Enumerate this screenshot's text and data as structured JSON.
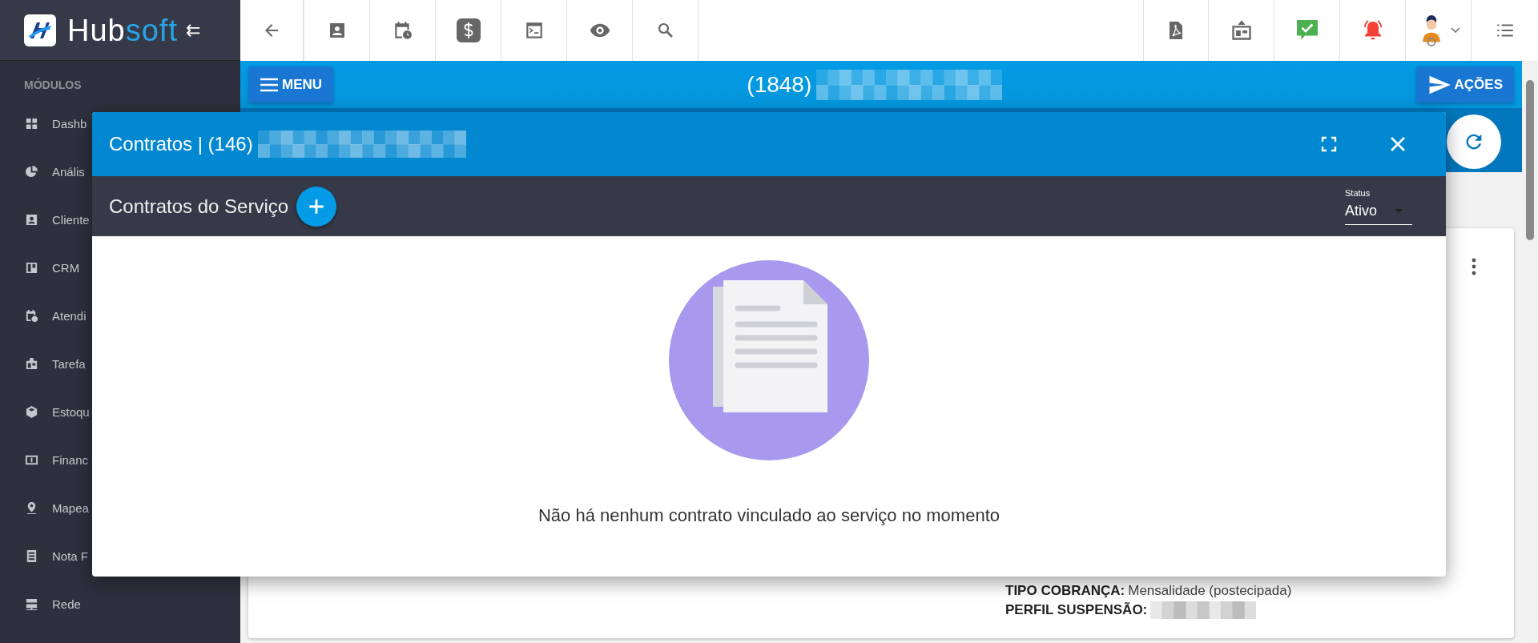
{
  "sidebar": {
    "logo": {
      "text_main": "Hub",
      "text_accent": "soft"
    },
    "collapse_icon": "⇇",
    "section_title": "MÓDULOS",
    "items": [
      {
        "label": "Dashb"
      },
      {
        "label": "Anális"
      },
      {
        "label": "Cliente"
      },
      {
        "label": "CRM"
      },
      {
        "label": "Atendi"
      },
      {
        "label": "Tarefa"
      },
      {
        "label": "Estoqu"
      },
      {
        "label": "Financ"
      },
      {
        "label": "Mapea"
      },
      {
        "label": "Nota F"
      },
      {
        "label": "Rede"
      }
    ]
  },
  "page_bar": {
    "menu_button": "MENU",
    "title": "(1848)",
    "actions_button": "AÇÕES"
  },
  "background_card": {
    "fields": [
      {
        "label": "TIPO COBRANÇA:",
        "value": "Mensalidade (postecipada)"
      },
      {
        "label": "PERFIL SUSPENSÃO:"
      }
    ]
  },
  "modal": {
    "title": "Contratos | (146)",
    "subtitle": "Contratos do Serviço",
    "status_filter": {
      "label": "Status",
      "value": "Ativo"
    },
    "empty_message": "Não há nenhum contrato vinculado ao serviço no momento"
  }
}
